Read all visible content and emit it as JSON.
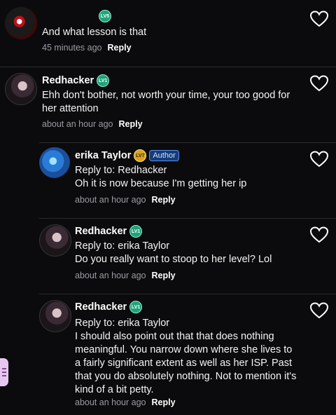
{
  "comments": [
    {
      "username": "",
      "level": "LV5",
      "author_badge": "",
      "reply_to": "",
      "text": "And what lesson is that",
      "time": "45 minutes ago",
      "reply_label": "Reply"
    },
    {
      "username": "Redhacker",
      "level": "LV1",
      "author_badge": "",
      "reply_to": "",
      "text": "Ehh don't bother, not worth your time, your too good for her attention",
      "time": "about an hour ago",
      "reply_label": "Reply"
    },
    {
      "username": "erika Taylor",
      "level": "LV7",
      "author_badge": "Author",
      "reply_to": "Reply to: Redhacker",
      "text": "Oh it is now because I'm getting her ip",
      "time": "about an hour ago",
      "reply_label": "Reply"
    },
    {
      "username": "Redhacker",
      "level": "LV1",
      "author_badge": "",
      "reply_to": "Reply to: erika Taylor",
      "text": "Do you really want to stoop to her level? Lol",
      "time": "about an hour ago",
      "reply_label": "Reply"
    },
    {
      "username": "Redhacker",
      "level": "LV1",
      "author_badge": "",
      "reply_to": "Reply to: erika Taylor",
      "text": "I should also point out that that does nothing meaningful. You narrow down where she lives to a fairly significant extent as well as her ISP. Past that you do absolutely nothing. Not to mention it's kind of a bit petty.",
      "time": "about an hour ago",
      "reply_label": "Reply"
    }
  ],
  "colors": {
    "background": "#0b0b0d",
    "level_badge": "#1ea37a",
    "author_badge": "#5b8fe6"
  },
  "icons": {
    "like": "heart-outline-icon",
    "side": "menu-tab-icon"
  }
}
